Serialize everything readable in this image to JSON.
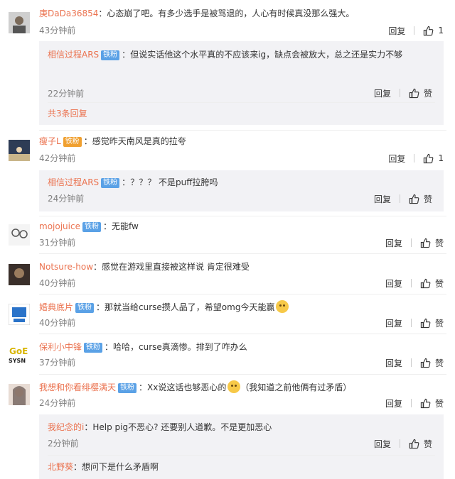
{
  "labels": {
    "reply": "回复",
    "like": "赞"
  },
  "comments": [
    {
      "user": "庚DaDa36854",
      "colon": "：",
      "text": "心态崩了吧。有多少选手是被骂退的，人心有时候真没那么强大。",
      "time": "43分钟前",
      "likes": "1"
    },
    {
      "user": "瘦子L",
      "badge": "铁粉",
      "colon": "：",
      "text": "感觉昨天南风是真的拉夸",
      "time": "42分钟前",
      "likes": "1"
    },
    {
      "user": "mojojuice",
      "badge": "铁粉",
      "colon": "：",
      "text": "无能fw",
      "time": "31分钟前"
    },
    {
      "user": "Notsure-how",
      "colon": "：",
      "text": "感觉在游戏里直接被这样说 肯定很难受",
      "time": "40分钟前"
    },
    {
      "user": "婚典底片",
      "badge": "铁粉",
      "colon": "：",
      "text": "那就当给curse攒人品了，希望omg今天能赢",
      "time": "40分钟前"
    },
    {
      "user": "保利小中锋",
      "badge": "铁粉",
      "colon": "：",
      "text": "哈哈，curse真滴惨。排到了咋办么",
      "time": "37分钟前"
    },
    {
      "user": "我想和你看绯樱满天",
      "badge": "铁粉",
      "colon": "：",
      "text": "Xx说这话也够恶心的",
      "text2": "（我知道之前他俩有过矛盾）",
      "time": "24分钟前"
    }
  ],
  "replies": [
    {
      "user": "相信过程ARS",
      "badge": "铁粉",
      "colon": "：",
      "text": "但说实话他这个水平真的不应该来ig，缺点会被放大，总之还是实力不够",
      "time": "22分钟前"
    },
    {
      "user": "相信过程ARS",
      "badge": "铁粉",
      "colon": "：",
      "text": "？？？ 不是puff拉胯吗",
      "time": "24分钟前"
    },
    {
      "user": "我纪念的i",
      "colon": "：",
      "text": "Help pig不恶心? 还要别人道歉。不是更加恶心",
      "time": "2分钟前"
    },
    {
      "user": "北野葵",
      "colon": "：",
      "text": "想问下是什么矛盾啊"
    }
  ],
  "more_replies": "共3条回复",
  "colors": {
    "username": "#eb7350",
    "badge": "#5aa1e6",
    "subbox": "#f2f2f5"
  }
}
